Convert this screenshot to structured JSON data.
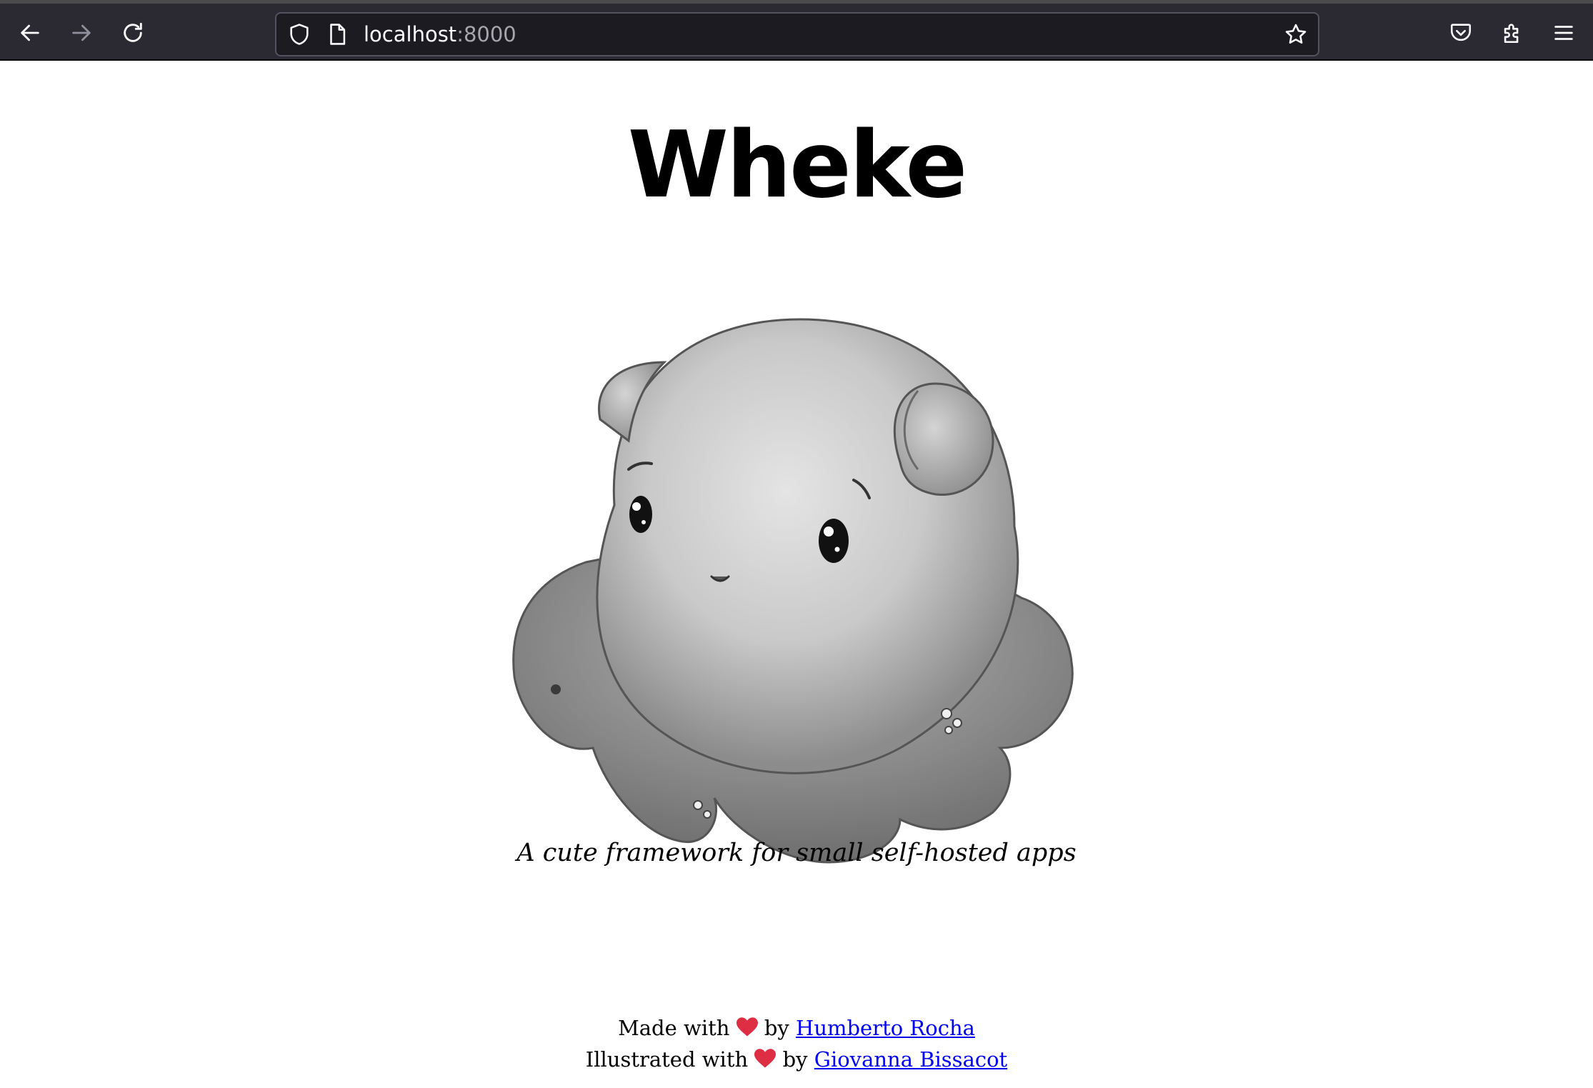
{
  "browser": {
    "url_host": "localhost",
    "url_port": ":8000"
  },
  "page": {
    "title": "Wheke",
    "tagline": "A cute framework for small self-hosted apps"
  },
  "footer": {
    "line1_prefix": "Made with",
    "line1_by": "by",
    "line1_link": "Humberto Rocha",
    "line2_prefix": "Illustrated with",
    "line2_by": "by",
    "line2_link": "Giovanna Bissacot"
  },
  "colors": {
    "link": "#0000ee",
    "heart": "#dd2e44",
    "toolbar": "#2b2a33"
  }
}
